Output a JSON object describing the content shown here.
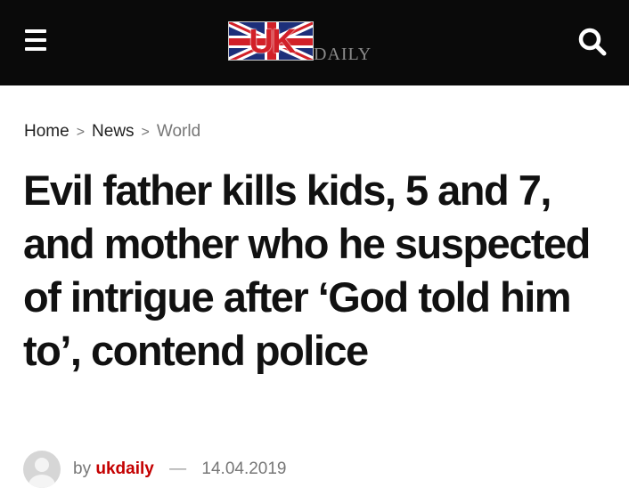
{
  "header": {
    "logo_flag_text": "UK",
    "logo_suffix_text": "DAILY",
    "menu_icon": "hamburger-menu-icon",
    "search_icon": "search-icon",
    "background_color": "#0a0a0a"
  },
  "breadcrumb": {
    "items": [
      "Home",
      "News",
      "World"
    ],
    "separator": ">"
  },
  "article": {
    "title": "Evil father kills kids, 5 and 7, and mother who he suspected of intrigue after ‘God told him to’, contend police",
    "byline_prefix": "by",
    "author": "ukdaily",
    "author_color": "#c40000",
    "dash": "—",
    "date": "14.04.2019"
  }
}
